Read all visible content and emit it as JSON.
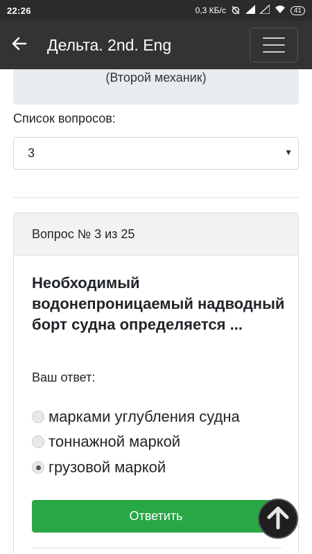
{
  "status_bar": {
    "time": "22:26",
    "net_speed": "0,3 КБ/с",
    "battery": "41",
    "icons": [
      "alarm-off-icon",
      "signal-icon",
      "signal-icon",
      "wifi-icon",
      "battery-icon"
    ]
  },
  "app_bar": {
    "back_icon": "arrow-left-icon",
    "title": "Дельта. 2nd. Eng",
    "menu_icon": "hamburger-menu-icon"
  },
  "info_panel": {
    "subtitle": "(Второй механик)"
  },
  "question_list": {
    "label": "Список вопросов:",
    "selected": "3"
  },
  "question": {
    "header": "Вопрос № 3 из 25",
    "text": "Необходимый водонепроницаемый надводный борт судна определяется ...",
    "answer_label": "Ваш ответ:",
    "options": [
      {
        "label": "марками углубления судна",
        "checked": false
      },
      {
        "label": "тоннажной маркой",
        "checked": false
      },
      {
        "label": "грузовой маркой",
        "checked": true
      }
    ],
    "submit_label": "Ответить"
  },
  "scroll_top_icon": "arrow-up-icon",
  "colors": {
    "app_bar": "#333333",
    "status_bar": "#2b2b2b",
    "submit_button": "#28a745",
    "panel": "#e9ecef"
  }
}
